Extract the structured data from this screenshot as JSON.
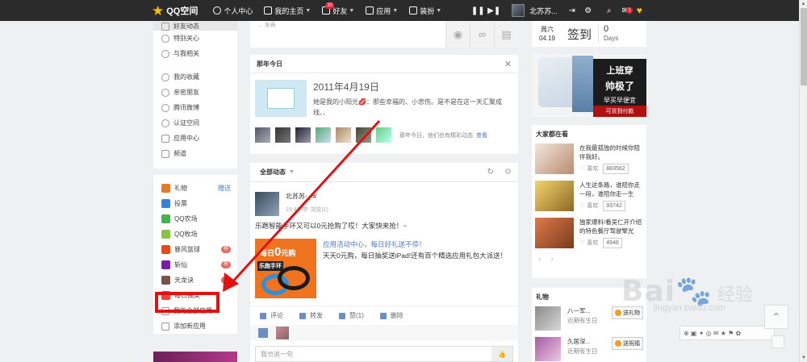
{
  "topbar": {
    "brand": "QQ空间",
    "nav": [
      {
        "label": "个人中心",
        "icon": "person-icon",
        "caret": false
      },
      {
        "label": "我的主页",
        "icon": "home-icon",
        "caret": true
      },
      {
        "label": "好友",
        "icon": "friends-icon",
        "caret": true,
        "badge": "30"
      },
      {
        "label": "应用",
        "icon": "apps-icon",
        "caret": true
      },
      {
        "label": "装扮",
        "icon": "shirt-icon",
        "caret": true
      }
    ],
    "username": "北苏苏...",
    "mail_badge": "1"
  },
  "sidebar": {
    "group1": [
      {
        "label": "好友动态",
        "icon": "feed-icon",
        "active": true
      },
      {
        "label": "特别关心",
        "icon": "heart-icon"
      },
      {
        "label": "与我相关",
        "icon": "at-icon"
      },
      {
        "label": "我的收藏",
        "icon": "star-icon"
      },
      {
        "label": "亲密朋友",
        "icon": "friends-icon"
      },
      {
        "label": "腾讯微博",
        "icon": "weibo-icon"
      },
      {
        "label": "认证空间",
        "icon": "verified-icon"
      },
      {
        "label": "应用中心",
        "icon": "grid-icon"
      },
      {
        "label": "频道",
        "icon": "camera-icon"
      }
    ],
    "group2": [
      {
        "label": "礼物",
        "extra": "赠送",
        "color": "#e57a2e"
      },
      {
        "label": "投票",
        "color": "#3b7fd4"
      },
      {
        "label": "QQ农场",
        "color": "#4caf50"
      },
      {
        "label": "QQ牧场",
        "color": "#8bc34a"
      },
      {
        "label": "暴风篮球",
        "pill": "荐",
        "color": "#e64a19"
      },
      {
        "label": "斩仙",
        "pill": "荐",
        "color": "#7b1fa2"
      },
      {
        "label": "天龙诀",
        "pill": "荐",
        "color": "#795548"
      },
      {
        "label": "每日抽奖",
        "color": "#f44336"
      },
      {
        "label": "我的全部应用",
        "icon": "grid-icon"
      },
      {
        "label": "添加新应用",
        "icon": "plus-icon"
      }
    ]
  },
  "post_top": {
    "tiny": "... 发表"
  },
  "today": {
    "title": "那年今日",
    "date": "2011年4月19日",
    "text_before": "她是我的小阳光",
    "lips": "💋",
    "text_after": "：那些幸福的、小悲伤。是不是在这一天汇聚成线、、",
    "note": "那年今日，他们也有精彩动态",
    "view": "查看"
  },
  "feed": {
    "filter": "全部动态",
    "author": "北苏苏-_-#",
    "time": "19:43",
    "views": "浏览(1)",
    "text": "乐跑智能手环又可以0元抢购了哎！大家快来抢！~",
    "promo": {
      "line1_prefix": "每日",
      "line1_num": "0",
      "line1_suffix": "元购",
      "line2": "乐跑手环"
    },
    "source": "应用活动中心，每日好礼送不停！",
    "desc": "天天0元购，每日抽奖送iPad!还有百个精选应用礼包大派送！",
    "actions": [
      "评论",
      "转发",
      "赞(1)",
      "删除"
    ],
    "comment_placeholder": "我也说一句"
  },
  "checkin": {
    "weekday": "周六",
    "date": "04.19",
    "sign": "签到",
    "days": "0",
    "unit": "Days"
  },
  "ad": {
    "line1": "上班穿",
    "line2": "帅极了",
    "line3": "早买早便宜",
    "line4": "可货到付款"
  },
  "popular": {
    "title": "大家都在看",
    "items": [
      {
        "text": "在我最孤独的时候你陪伴我好。",
        "likes": "喜欢",
        "count": "883562"
      },
      {
        "text": "人生这条路，谁陪你走一段，谁陪你走一生",
        "likes": "喜欢",
        "count": "93742"
      },
      {
        "text": "独家爆料!看吴仁开介绍的特色餐厅驾驶擎光",
        "likes": "喜欢",
        "count": "4946"
      }
    ]
  },
  "gifts": {
    "title": "礼物",
    "items": [
      {
        "name": "八一军...",
        "sub": "近期有生日",
        "btn": "送礼物"
      },
      {
        "name": "久居深...",
        "sub": "近期有生日",
        "btn": "送祝福"
      }
    ]
  },
  "watermark": {
    "logo": "Bai",
    "cn": "经验",
    "url": "jingyan.baidu.com"
  },
  "colors": {
    "topbar": "#2b2b2b",
    "highlight": "#e31212",
    "accent": "#4a7bc8"
  }
}
